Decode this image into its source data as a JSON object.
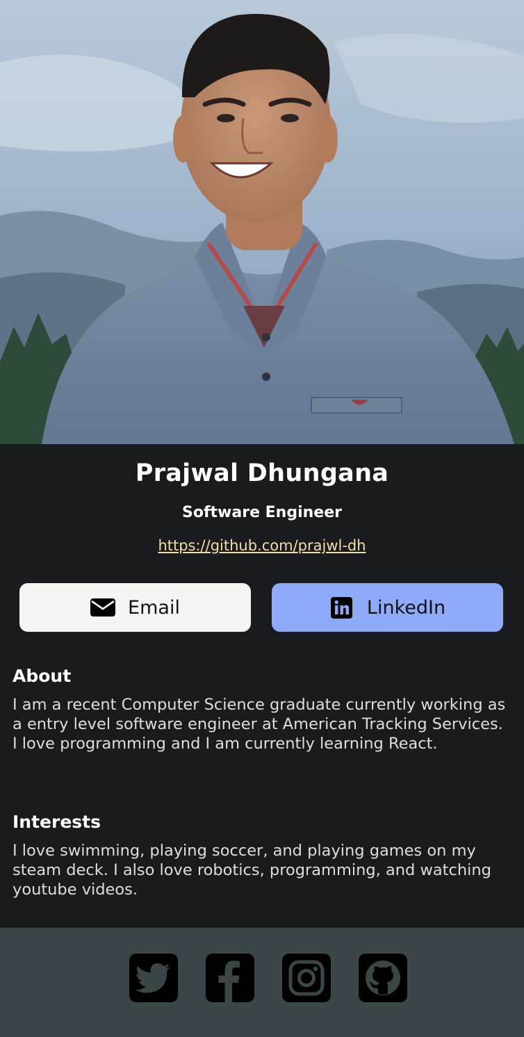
{
  "profile": {
    "name": "Prajwal Dhungana",
    "role": "Software Engineer",
    "link": "https://github.com/prajwl-dh"
  },
  "buttons": {
    "email": {
      "label": "Email",
      "icon": "envelope-icon"
    },
    "linkedin": {
      "label": "LinkedIn",
      "icon": "linkedin-icon"
    }
  },
  "about": {
    "title": "About",
    "body": "I am a recent Computer Science graduate currently working as a entry level software engineer at American Tracking Services. I love programming and I am currently learning React."
  },
  "interests": {
    "title": "Interests",
    "body": "I love swimming, playing soccer, and playing games on my steam deck. I also love robotics, programming, and watching youtube videos."
  },
  "footer": {
    "socials": [
      "twitter-icon",
      "facebook-icon",
      "instagram-icon",
      "github-icon"
    ]
  },
  "colors": {
    "card_background": "#1a1b1f",
    "footer_background": "#3a4647",
    "email_button": "#f5f6f4",
    "linkedin_button": "#8eaaf9",
    "link": "#f3dfa6"
  }
}
